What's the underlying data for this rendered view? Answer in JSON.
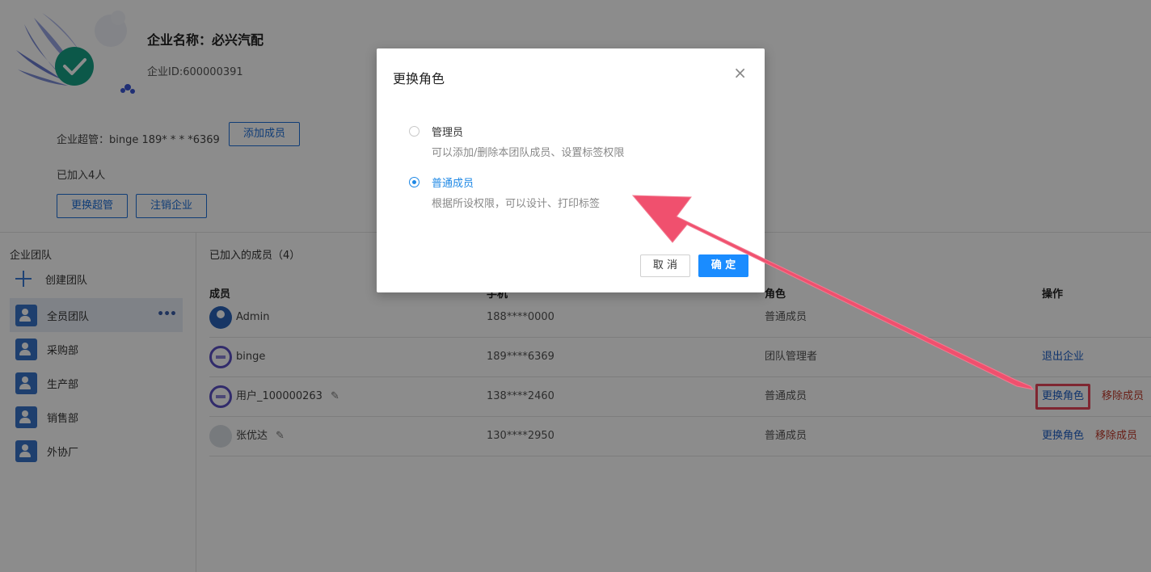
{
  "header": {
    "company_name": "企业名称：必兴汽配",
    "company_id": "企业ID:600000391",
    "super_admin": "企业超管：binge 189* * * *6369",
    "add_member_label": "添加成员",
    "joined_count": "已加入4人",
    "change_admin_label": "更换超管",
    "cancel_enterprise_label": "注销企业"
  },
  "sidebar": {
    "title": "企业团队",
    "create_team_label": "创建团队",
    "more_label": "•••",
    "teams": [
      {
        "label": "全员团队"
      },
      {
        "label": "采购部"
      },
      {
        "label": "生产部"
      },
      {
        "label": "销售部"
      },
      {
        "label": "外协厂"
      }
    ]
  },
  "main": {
    "section_title": "已加入的成员（4）",
    "columns": {
      "member": "成员",
      "phone": "手机",
      "role": "角色",
      "ops": "操作"
    },
    "rows": [
      {
        "name": "Admin",
        "phone": "188****0000",
        "role": "普通成员"
      },
      {
        "name": "binge",
        "phone": "189****6369",
        "role": "团队管理者",
        "op1": "退出企业"
      },
      {
        "name": "用户_100000263",
        "phone": "138****2460",
        "role": "普通成员",
        "op1": "更换角色",
        "op2": "移除成员"
      },
      {
        "name": "张优达",
        "phone": "130****2950",
        "role": "普通成员",
        "op1": "更换角色",
        "op2": "移除成员"
      }
    ]
  },
  "dialog": {
    "title": "更换角色",
    "close_icon": "×",
    "options": [
      {
        "label": "管理员",
        "desc": "可以添加/删除本团队成员、设置标签权限",
        "checked": false
      },
      {
        "label": "普通成员",
        "desc": "根据所设权限，可以设计、打印标签",
        "checked": true
      }
    ],
    "cancel_label": "取 消",
    "ok_label": "确 定"
  },
  "colors": {
    "primary": "#1a8cff",
    "link": "#1e5fc6",
    "danger": "#c0392b",
    "annotation": "#f0506e"
  }
}
